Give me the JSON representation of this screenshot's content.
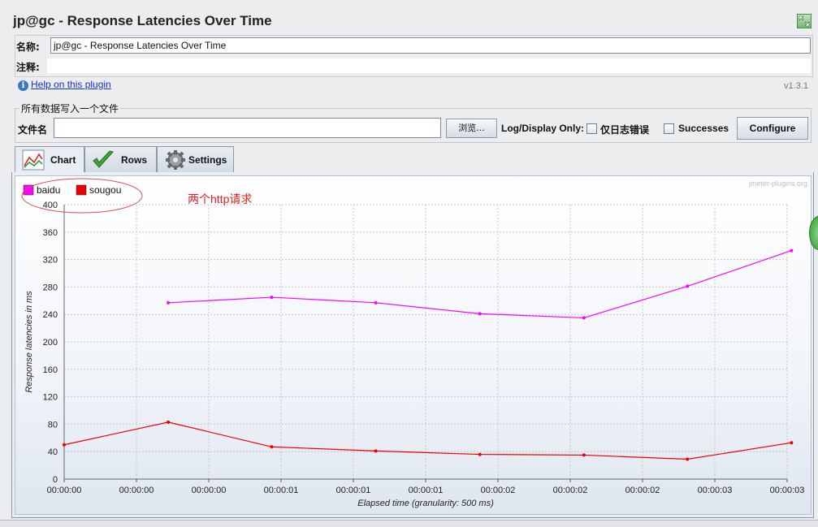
{
  "window": {
    "title": "jp@gc - Response Latencies Over Time"
  },
  "name_row": {
    "label": "名称:",
    "value": "jp@gc - Response Latencies Over Time"
  },
  "comment_row": {
    "label": "注释:",
    "value": ""
  },
  "help": {
    "link_text": "Help on this plugin",
    "version": "v1.3.1"
  },
  "file_section": {
    "legend": "所有数据写入一个文件",
    "filename_label": "文件名",
    "filename_value": "",
    "browse_label": "浏览...",
    "log_display_label": "Log/Display Only:",
    "errors_label": "仅日志错误",
    "successes_label": "Successes",
    "configure_label": "Configure"
  },
  "tabs": [
    {
      "label": "Chart",
      "icon": "chart-icon",
      "active": true
    },
    {
      "label": "Rows",
      "icon": "checkmark-icon",
      "active": false
    },
    {
      "label": "Settings",
      "icon": "gear-icon",
      "active": false
    }
  ],
  "chart_meta": {
    "watermark": "jmeter-plugins.org",
    "annotation": "两个http请求",
    "annotation_color": "#e02020"
  },
  "chart_data": {
    "type": "line",
    "xlabel": "Elapsed time (granularity: 500 ms)",
    "ylabel": "Response latencies in ms",
    "ylim": [
      0,
      400
    ],
    "yticks": [
      0,
      40,
      80,
      120,
      160,
      200,
      240,
      280,
      320,
      360,
      400
    ],
    "xtick_labels": [
      "00:00:00",
      "00:00:00",
      "00:00:00",
      "00:00:01",
      "00:00:01",
      "00:00:01",
      "00:00:02",
      "00:00:02",
      "00:00:02",
      "00:00:03",
      "00:00:03"
    ],
    "grid": true,
    "legend_position": "top-left",
    "series": [
      {
        "name": "baidu",
        "color": "#ff00ff",
        "points": [
          [
            1.44,
            257
          ],
          [
            2.87,
            265
          ],
          [
            4.31,
            257
          ],
          [
            5.75,
            241
          ],
          [
            7.19,
            235
          ],
          [
            8.62,
            281
          ],
          [
            10.06,
            333
          ]
        ]
      },
      {
        "name": "sougou",
        "color": "#ee0000",
        "points": [
          [
            0,
            50
          ],
          [
            1.44,
            83
          ],
          [
            2.87,
            47
          ],
          [
            4.31,
            41
          ],
          [
            5.75,
            36
          ],
          [
            7.19,
            35
          ],
          [
            8.62,
            29
          ],
          [
            10.06,
            53
          ]
        ]
      }
    ]
  }
}
